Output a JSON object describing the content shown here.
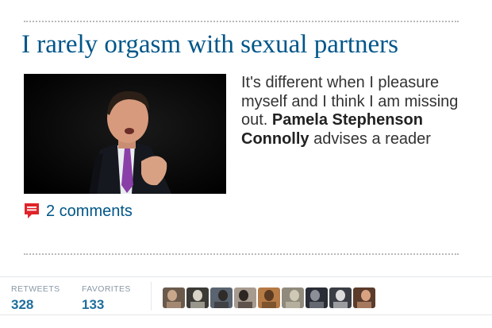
{
  "article": {
    "headline": "I rarely orgasm with sexual partners",
    "standfirst_lead": "It's different when I pleasure myself and I think I am missing out. ",
    "standfirst_author": "Pamela Stephenson Connolly",
    "standfirst_tail": " advises a reader",
    "comments_label": "2 comments"
  },
  "stats": {
    "retweets_label": "RETWEETS",
    "retweets_value": "328",
    "favorites_label": "FAVORITES",
    "favorites_value": "133"
  },
  "avatars": [
    {
      "color": "#6b5a4c",
      "accent": "#c9a78a"
    },
    {
      "color": "#3b3a36",
      "accent": "#d9d4c7"
    },
    {
      "color": "#5a6470",
      "accent": "#2f2b28"
    },
    {
      "color": "#a79a8f",
      "accent": "#2d2622"
    },
    {
      "color": "#b57a45",
      "accent": "#5a3a22"
    },
    {
      "color": "#8f8a7c",
      "accent": "#cfc8b4"
    },
    {
      "color": "#2a2d35",
      "accent": "#8c8f98"
    },
    {
      "color": "#3a3d44",
      "accent": "#dcdcdc"
    },
    {
      "color": "#5b3b2c",
      "accent": "#d9a382"
    }
  ],
  "colors": {
    "headline": "#005689",
    "link": "#005689",
    "comment_icon": "#e0242a",
    "stat_value": "#1f6e9c"
  },
  "icons": {
    "comments": "speech-bubble-icon"
  }
}
